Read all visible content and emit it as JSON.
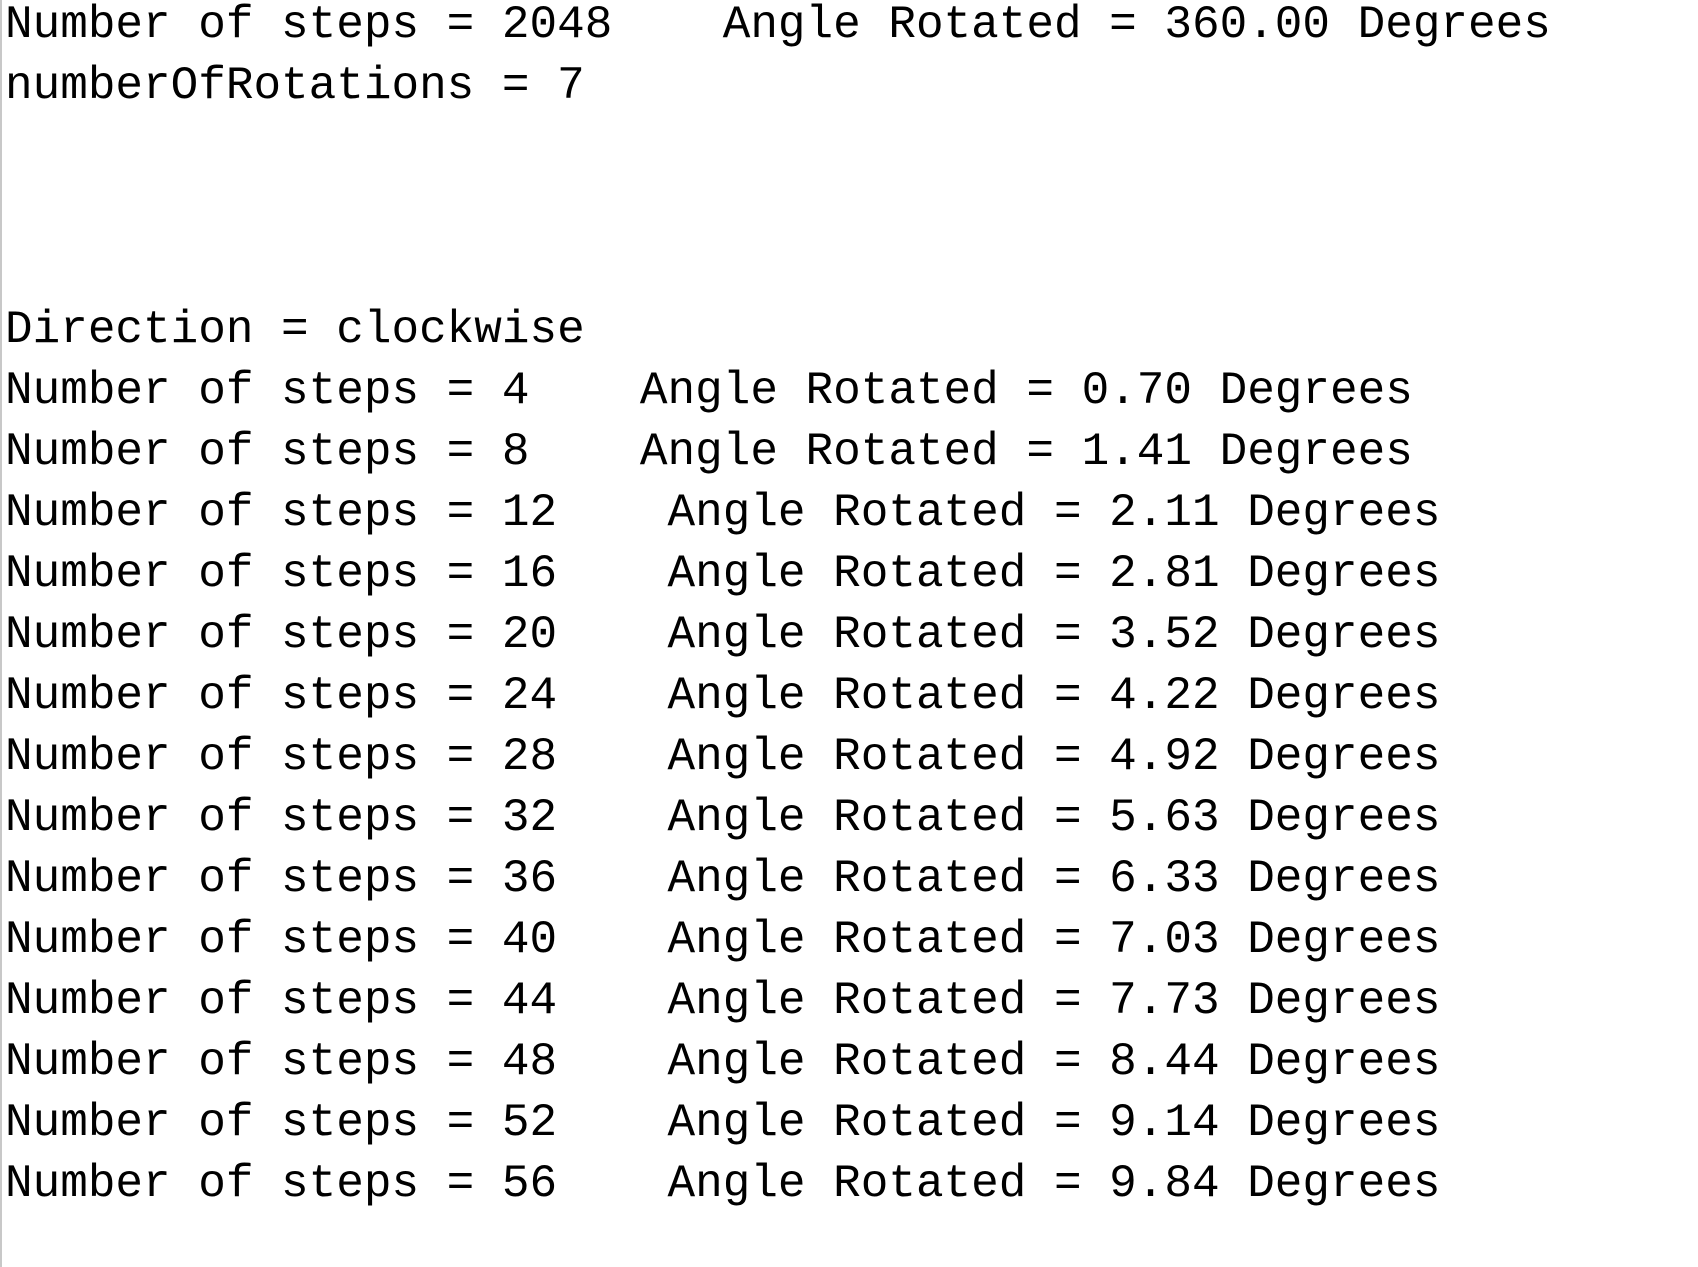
{
  "console": {
    "header_lines": [
      "Number of steps = 2048    Angle Rotated = 360.00 Degrees",
      "numberOfRotations = 7"
    ],
    "direction_line": "Direction = clockwise",
    "step_lines": [
      "Number of steps = 4    Angle Rotated = 0.70 Degrees",
      "Number of steps = 8    Angle Rotated = 1.41 Degrees",
      "Number of steps = 12    Angle Rotated = 2.11 Degrees",
      "Number of steps = 16    Angle Rotated = 2.81 Degrees",
      "Number of steps = 20    Angle Rotated = 3.52 Degrees",
      "Number of steps = 24    Angle Rotated = 4.22 Degrees",
      "Number of steps = 28    Angle Rotated = 4.92 Degrees",
      "Number of steps = 32    Angle Rotated = 5.63 Degrees",
      "Number of steps = 36    Angle Rotated = 6.33 Degrees",
      "Number of steps = 40    Angle Rotated = 7.03 Degrees",
      "Number of steps = 44    Angle Rotated = 7.73 Degrees",
      "Number of steps = 48    Angle Rotated = 8.44 Degrees",
      "Number of steps = 52    Angle Rotated = 9.14 Degrees",
      "Number of steps = 56    Angle Rotated = 9.84 Degrees"
    ]
  }
}
